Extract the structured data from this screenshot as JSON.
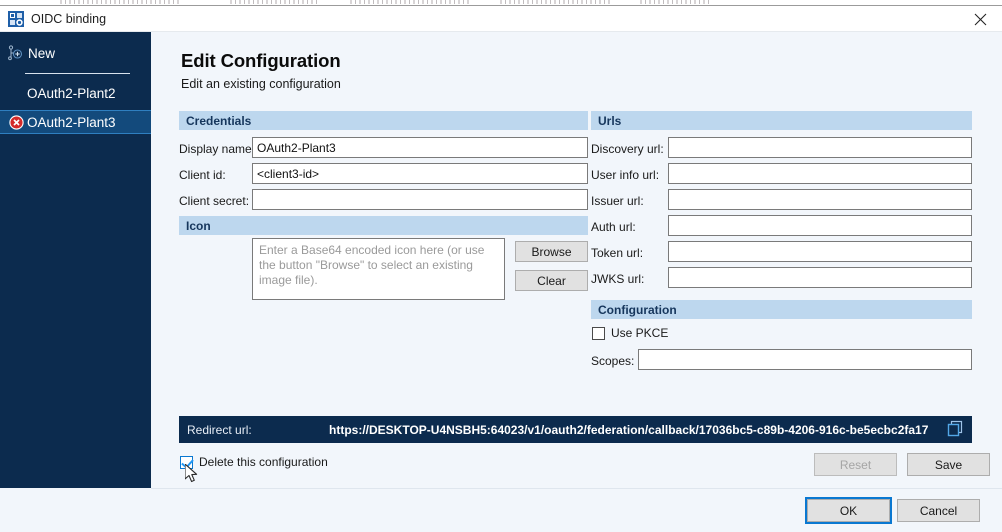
{
  "window": {
    "title": "OIDC binding",
    "app_icon": "oidc-binding-icon",
    "close_icon": "close-icon"
  },
  "sidebar": {
    "new_label": "New",
    "new_icon": "new-node-icon",
    "items": [
      {
        "label": "OAuth2-Plant2",
        "icon": null,
        "selected": false
      },
      {
        "label": "OAuth2-Plant3",
        "icon": "error-delete-icon",
        "selected": true
      }
    ]
  },
  "header": {
    "title": "Edit Configuration",
    "subtitle": "Edit an existing configuration"
  },
  "sections": {
    "credentials": {
      "title": "Credentials",
      "fields": [
        {
          "label": "Display name:",
          "value": "OAuth2-Plant3"
        },
        {
          "label": "Client id:",
          "value": "<client3-id>"
        },
        {
          "label": "Client secret:",
          "value": ""
        }
      ]
    },
    "icon": {
      "title": "Icon",
      "placeholder": "Enter a Base64 encoded icon here (or use the button \"Browse\" to select an existing image file).",
      "value": "",
      "browse_label": "Browse",
      "clear_label": "Clear"
    },
    "urls": {
      "title": "Urls",
      "fields": [
        {
          "label": "Discovery url:",
          "value": ""
        },
        {
          "label": "User info url:",
          "value": ""
        },
        {
          "label": "Issuer url:",
          "value": ""
        },
        {
          "label": "Auth url:",
          "value": ""
        },
        {
          "label": "Token url:",
          "value": ""
        },
        {
          "label": "JWKS url:",
          "value": ""
        }
      ]
    },
    "configuration": {
      "title": "Configuration",
      "use_pkce_label": "Use PKCE",
      "use_pkce_checked": false,
      "scopes_label": "Scopes:",
      "scopes_value": ""
    }
  },
  "redirect": {
    "label": "Redirect url:",
    "value": "https://DESKTOP-U4NSBH5:64023/v1/oauth2/federation/callback/17036bc5-c89b-4206-916c-be5ecbc2fa17",
    "copy_icon": "copy-icon"
  },
  "delete": {
    "label": "Delete this configuration",
    "checked": true
  },
  "buttons": {
    "reset": {
      "label": "Reset",
      "disabled": true
    },
    "save": {
      "label": "Save",
      "disabled": false
    },
    "ok": {
      "label": "OK",
      "focused": true
    },
    "cancel": {
      "label": "Cancel",
      "focused": false
    }
  },
  "colors": {
    "sidebar_bg": "#0c2b4e",
    "sidebar_selected": "#134a7c",
    "section_header": "#bdd7ee",
    "section_header_text": "#16365c",
    "page_bg": "#f2f6fb",
    "accent_focus": "#0a78d1",
    "error_red": "#d42a2a"
  }
}
